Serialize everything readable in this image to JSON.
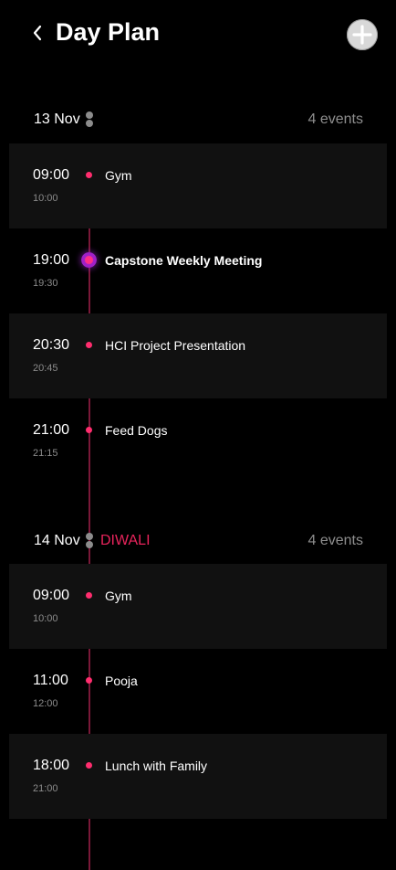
{
  "header": {
    "title": "Day Plan",
    "back_icon": "chevron-left-icon",
    "add_icon": "plus-icon"
  },
  "colors": {
    "background": "#000000",
    "accent": "#ff2d6e",
    "holiday": "#e8245c",
    "active_dot": "#a020c8",
    "muted_text": "#8e8e8e"
  },
  "days": [
    {
      "date": "13 Nov",
      "holiday": "",
      "event_count": "4 events",
      "events": [
        {
          "start": "09:00",
          "end": "10:00",
          "title": "Gym",
          "active": false
        },
        {
          "start": "19:00",
          "end": "19:30",
          "title": "Capstone Weekly Meeting",
          "active": true
        },
        {
          "start": "20:30",
          "end": "20:45",
          "title": "HCI Project Presentation",
          "active": false
        },
        {
          "start": "21:00",
          "end": "21:15",
          "title": "Feed Dogs",
          "active": false
        }
      ]
    },
    {
      "date": "14 Nov",
      "holiday": "DIWALI",
      "event_count": "4 events",
      "events": [
        {
          "start": "09:00",
          "end": "10:00",
          "title": "Gym",
          "active": false
        },
        {
          "start": "11:00",
          "end": "12:00",
          "title": "Pooja",
          "active": false
        },
        {
          "start": "18:00",
          "end": "21:00",
          "title": "Lunch with Family",
          "active": false
        }
      ]
    }
  ]
}
